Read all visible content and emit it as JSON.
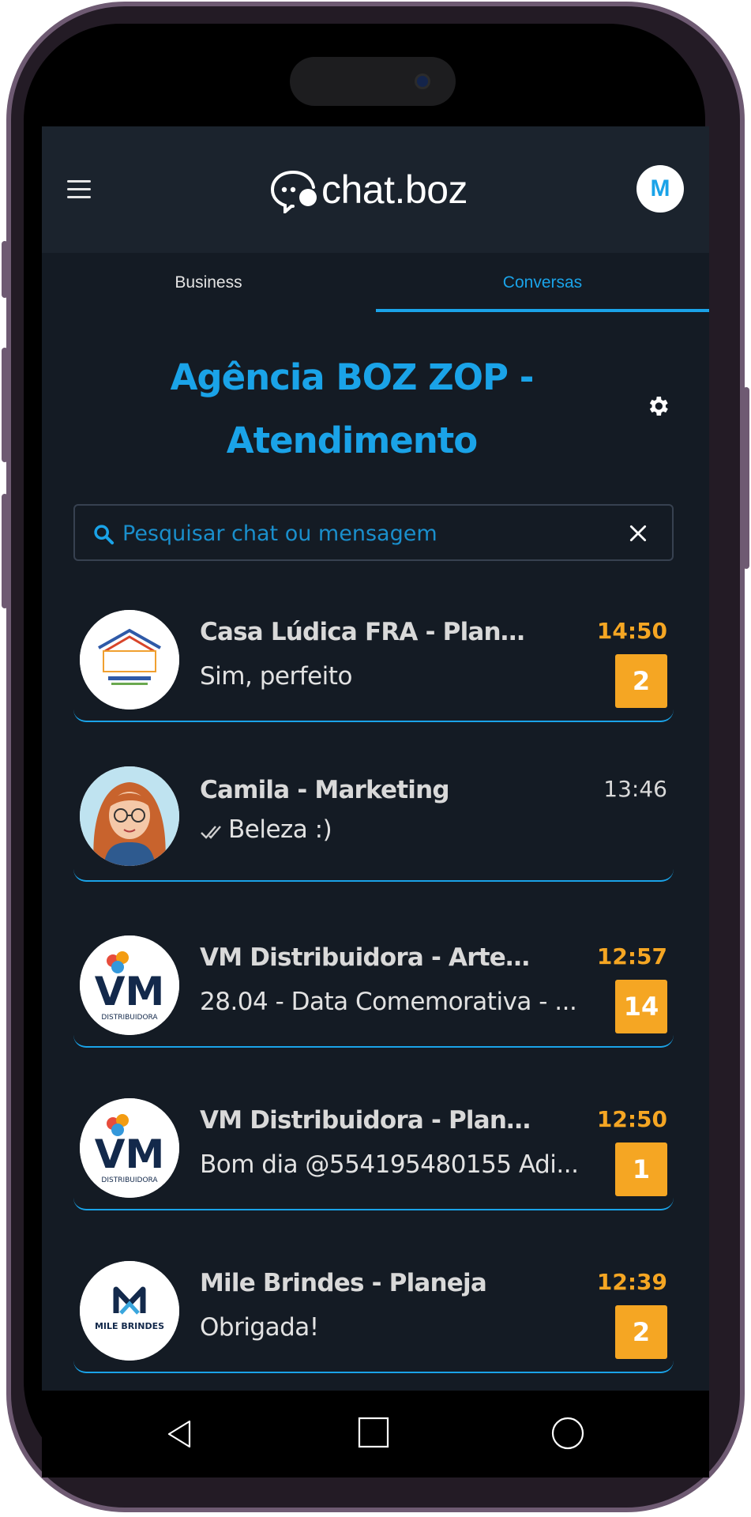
{
  "app": {
    "logo_text": "chat.boz",
    "user_initial": "M",
    "brand_color": "#1aa3e8",
    "unread_color": "#f5a623"
  },
  "tabs": [
    {
      "label": "Business"
    },
    {
      "label": "Conversas"
    }
  ],
  "page": {
    "title": "Agência BOZ ZOP - Atendimento"
  },
  "search": {
    "placeholder": "Pesquisar chat ou mensagem",
    "value": ""
  },
  "chats": [
    {
      "name": "Casa Lúdica FRA - Planeja",
      "message": "Sim, perfeito",
      "time": "14:50",
      "unread": "2",
      "avatar": "casa-ludica-logo"
    },
    {
      "name": "Camila - Marketing",
      "message": "Beleza :)",
      "time": "13:46",
      "unread": "",
      "read_receipt": "double-check-icon",
      "avatar": "camila-photo"
    },
    {
      "name": "VM Distribuidora - Arte/...",
      "message": "28.04 - Data Comemorativa - ...",
      "time": "12:57",
      "unread": "14",
      "avatar": "vm-distribuidora-logo",
      "avatar_text": "VM",
      "avatar_caption": "DISTRIBUIDORA"
    },
    {
      "name": "VM Distribuidora - Planeja",
      "message": "Bom dia @554195480155 Adi...",
      "time": "12:50",
      "unread": "1",
      "avatar": "vm-distribuidora-logo",
      "avatar_text": "VM",
      "avatar_caption": "DISTRIBUIDORA"
    },
    {
      "name": "Mile Brindes - Planeja",
      "message": "Obrigada!",
      "time": "12:39",
      "unread": "2",
      "avatar": "mile-brindes-logo",
      "avatar_caption": "MILE BRINDES"
    }
  ],
  "system_nav": {
    "back": "back-icon",
    "home": "home-icon",
    "recents": "recents-icon"
  }
}
